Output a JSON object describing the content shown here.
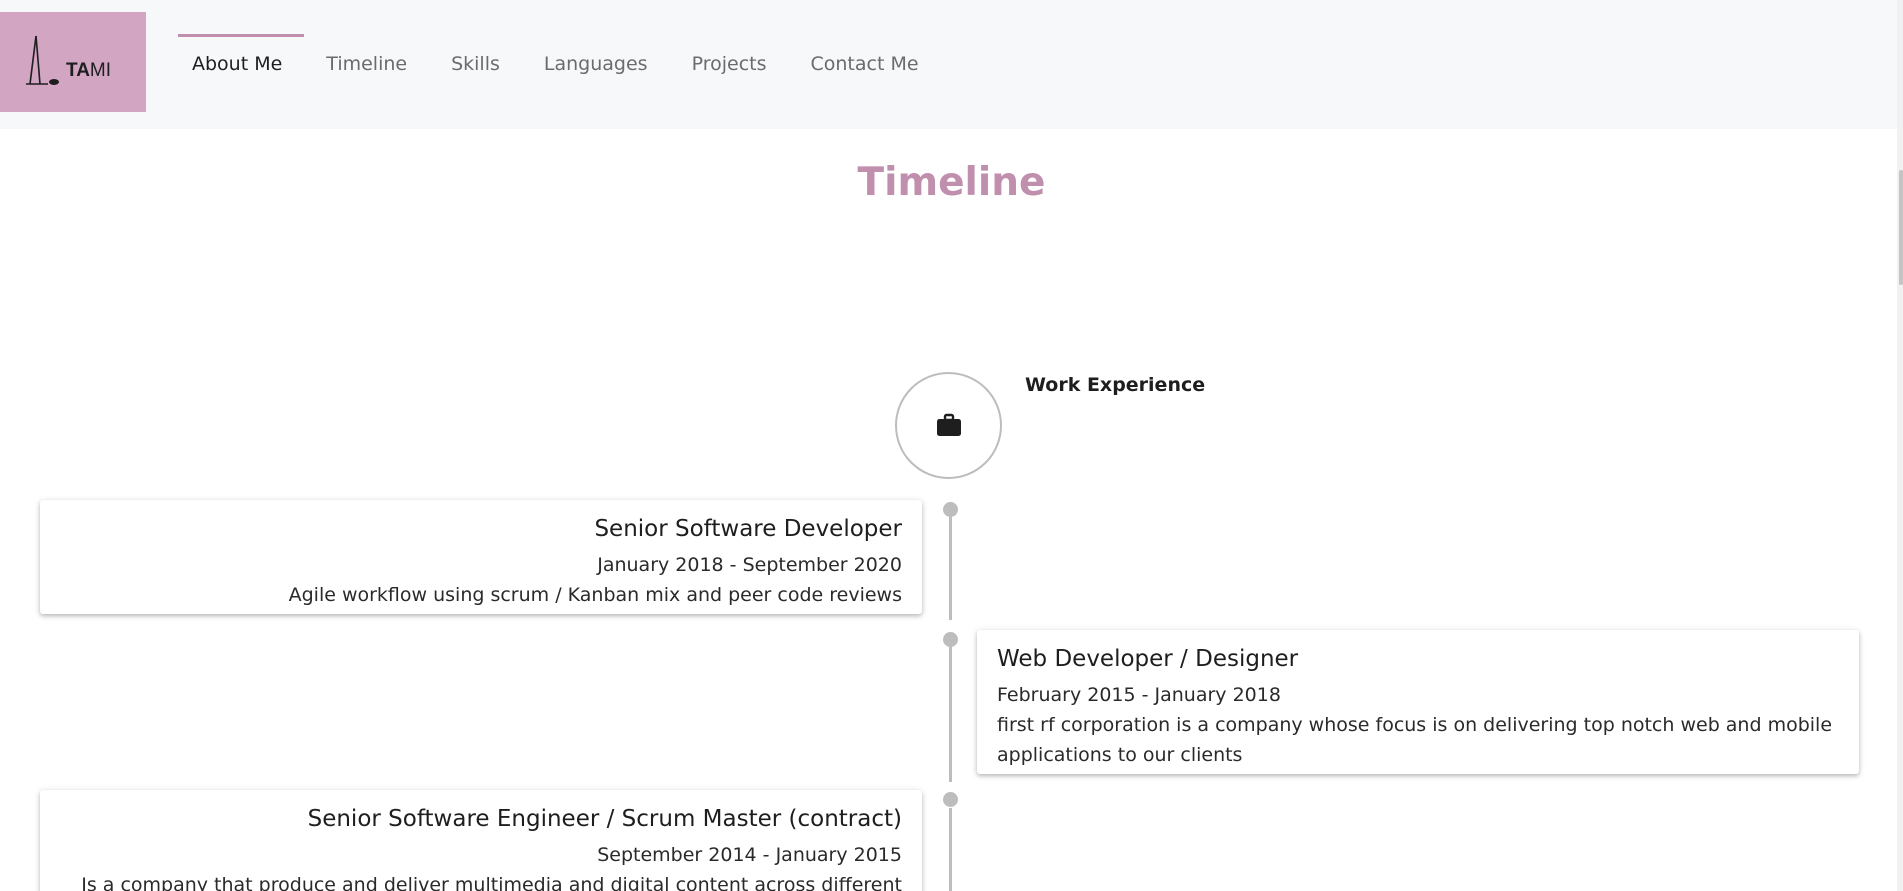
{
  "logo": {
    "text_bold": "TA",
    "text_light": "MI"
  },
  "nav": {
    "items": [
      {
        "label": "About Me",
        "active": true
      },
      {
        "label": "Timeline",
        "active": false
      },
      {
        "label": "Skills",
        "active": false
      },
      {
        "label": "Languages",
        "active": false
      },
      {
        "label": "Projects",
        "active": false
      },
      {
        "label": "Contact Me",
        "active": false
      }
    ]
  },
  "section": {
    "title": "Timeline"
  },
  "timeline": {
    "heading": {
      "icon": "briefcase-icon",
      "label": "Work Experience"
    },
    "entries": [
      {
        "side": "left",
        "title": "Senior Software Developer",
        "dates": "January 2018 - September 2020",
        "description": "Agile workflow using scrum / Kanban mix and peer code reviews"
      },
      {
        "side": "right",
        "title": "Web Developer / Designer",
        "dates": "February 2015 - January 2018",
        "description": "first rf corporation is a company whose focus is on delivering top notch web and mobile applications to our clients"
      },
      {
        "side": "left",
        "title": "Senior Software Engineer / Scrum Master (contract)",
        "dates": "September 2014 - January 2015",
        "description": "Is a company that produce and deliver multimedia and digital content across different"
      }
    ]
  },
  "colors": {
    "accent": "#c18fae",
    "logo_bg": "#d2a5c2",
    "header_bg": "#f7f8fa",
    "timeline_gray": "#bdbdbd"
  }
}
